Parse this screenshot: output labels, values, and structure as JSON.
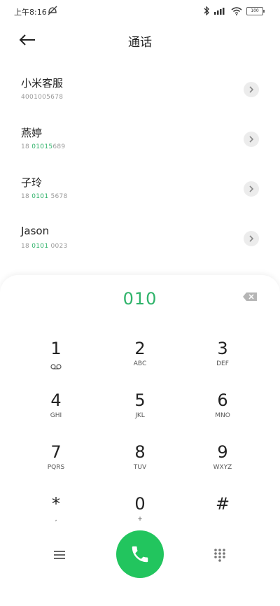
{
  "status_bar": {
    "time": "上午8:16",
    "battery": "100"
  },
  "header": {
    "title": "通话"
  },
  "contacts": [
    {
      "name": "小米客服",
      "number_match": "",
      "number_rest": "4001005678"
    },
    {
      "name": "燕婷",
      "number_prefix": "18",
      "number_match": "01015",
      "number_rest": "689"
    },
    {
      "name": "子玲",
      "number_prefix": "18",
      "number_match": "0101",
      "number_rest": " 5678"
    },
    {
      "name": "Jason",
      "number_prefix": "18",
      "number_match": "0101",
      "number_rest": " 0023"
    }
  ],
  "dialer": {
    "dialed_number": "010",
    "keys": [
      {
        "digit": "1",
        "letters": "voicemail-icon"
      },
      {
        "digit": "2",
        "letters": "ABC"
      },
      {
        "digit": "3",
        "letters": "DEF"
      },
      {
        "digit": "4",
        "letters": "GHI"
      },
      {
        "digit": "5",
        "letters": "JKL"
      },
      {
        "digit": "6",
        "letters": "MNO"
      },
      {
        "digit": "7",
        "letters": "PQRS"
      },
      {
        "digit": "8",
        "letters": "TUV"
      },
      {
        "digit": "9",
        "letters": "WXYZ"
      },
      {
        "digit": "*",
        "letters": ","
      },
      {
        "digit": "0",
        "letters": "+"
      },
      {
        "digit": "#",
        "letters": ""
      }
    ]
  },
  "colors": {
    "accent": "#2fb36a",
    "call_button": "#22c55e"
  }
}
